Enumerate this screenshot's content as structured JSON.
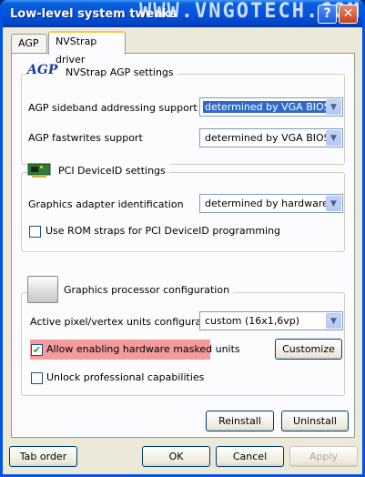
{
  "window": {
    "title": "Low-level system tweaks",
    "watermark": "WWW.VNGOTECH.COM",
    "help_glyph": "?",
    "close_glyph": "✕"
  },
  "tabs": [
    {
      "label": "AGP",
      "selected": false
    },
    {
      "label": "NVStrap driver",
      "selected": true
    }
  ],
  "agp_group": {
    "title": "NVStrap AGP settings",
    "logo_text": "AGP",
    "rows": [
      {
        "label": "AGP sideband addressing support",
        "value": "determined by VGA BIOS"
      },
      {
        "label": "AGP fastwrites support",
        "value": "determined by VGA BIOS"
      }
    ]
  },
  "pci_group": {
    "title": "PCI DeviceID settings",
    "row": {
      "label": "Graphics adapter identification",
      "value": "determined by hardware"
    },
    "checkbox": {
      "label": "Use ROM straps for PCI DeviceID programming",
      "checked": false
    }
  },
  "gpu_group": {
    "title": "Graphics processor configuration",
    "row": {
      "label": "Active pixel/vertex units configuration",
      "value": "custom (16x1,6vp)"
    },
    "checkbox_masked": {
      "label": "Allow enabling hardware masked units",
      "checked": true
    },
    "customize_label": "Customize",
    "checkbox_pro": {
      "label": "Unlock professional capabilities",
      "checked": false
    }
  },
  "panel_buttons": {
    "reinstall": "Reinstall",
    "uninstall": "Uninstall"
  },
  "footer": {
    "tab_order": "Tab order",
    "ok": "OK",
    "cancel": "Cancel",
    "apply": "Apply"
  },
  "colors": {
    "title_bar": "#0454df",
    "highlight": "#f49b9b",
    "selection": "#316ac5"
  }
}
